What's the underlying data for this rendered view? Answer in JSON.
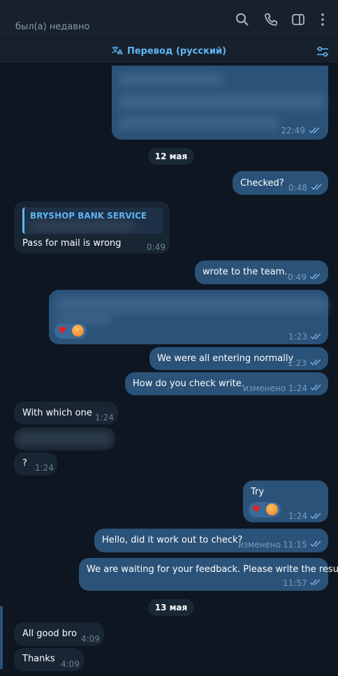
{
  "header": {
    "status": "был(а) недавно",
    "icons": [
      "search-icon",
      "phone-icon",
      "sidebar-toggle-icon",
      "more-vert-icon"
    ]
  },
  "translate_bar": {
    "label": "Перевод (русский)",
    "icon": "translate-icon",
    "settings_icon": "filter-settings-icon"
  },
  "dates": {
    "may12": "12 мая",
    "may13": "13 мая"
  },
  "messages": [
    {
      "dir": "out",
      "text": "",
      "time": "22:49",
      "note": "blurred"
    },
    {
      "dir": "out",
      "text": "Checked?",
      "time": "0:48"
    },
    {
      "dir": "in",
      "reply_to": "BRYSHOP BANK SERVICE",
      "text": "Pass for mail is wrong",
      "time": "0:49"
    },
    {
      "dir": "out",
      "text": "wrote to the team.",
      "time": "0:49"
    },
    {
      "dir": "out",
      "text": "",
      "time": "1:23",
      "reactions": [
        "heart",
        "emoji"
      ]
    },
    {
      "dir": "out",
      "text": "We were all entering normally",
      "time": "1:23"
    },
    {
      "dir": "out",
      "text": "How do you check write.",
      "time": "1:24",
      "edited": "изменено"
    },
    {
      "dir": "in",
      "text": "With which one",
      "time": "1:24"
    },
    {
      "dir": "in",
      "text": "",
      "time": ""
    },
    {
      "dir": "in",
      "text": "?",
      "time": "1:24"
    },
    {
      "dir": "out",
      "text": "Try",
      "time": "1:24",
      "reactions": [
        "heart",
        "emoji"
      ]
    },
    {
      "dir": "out",
      "text": "Hello, did it work out to check?",
      "time": "11:15",
      "edited": "изменено"
    },
    {
      "dir": "out",
      "text": "We are waiting for your feedback. Please write the result.",
      "time": "11:57"
    },
    {
      "dir": "in",
      "text": "All good bro",
      "time": "4:09"
    },
    {
      "dir": "in",
      "text": "Thanks",
      "time": "4:09"
    }
  ],
  "colors": {
    "background": "#0e1621",
    "header": "#17212b",
    "outgoing": "#2b5278",
    "incoming": "#182533",
    "accent": "#5eb5f7"
  }
}
